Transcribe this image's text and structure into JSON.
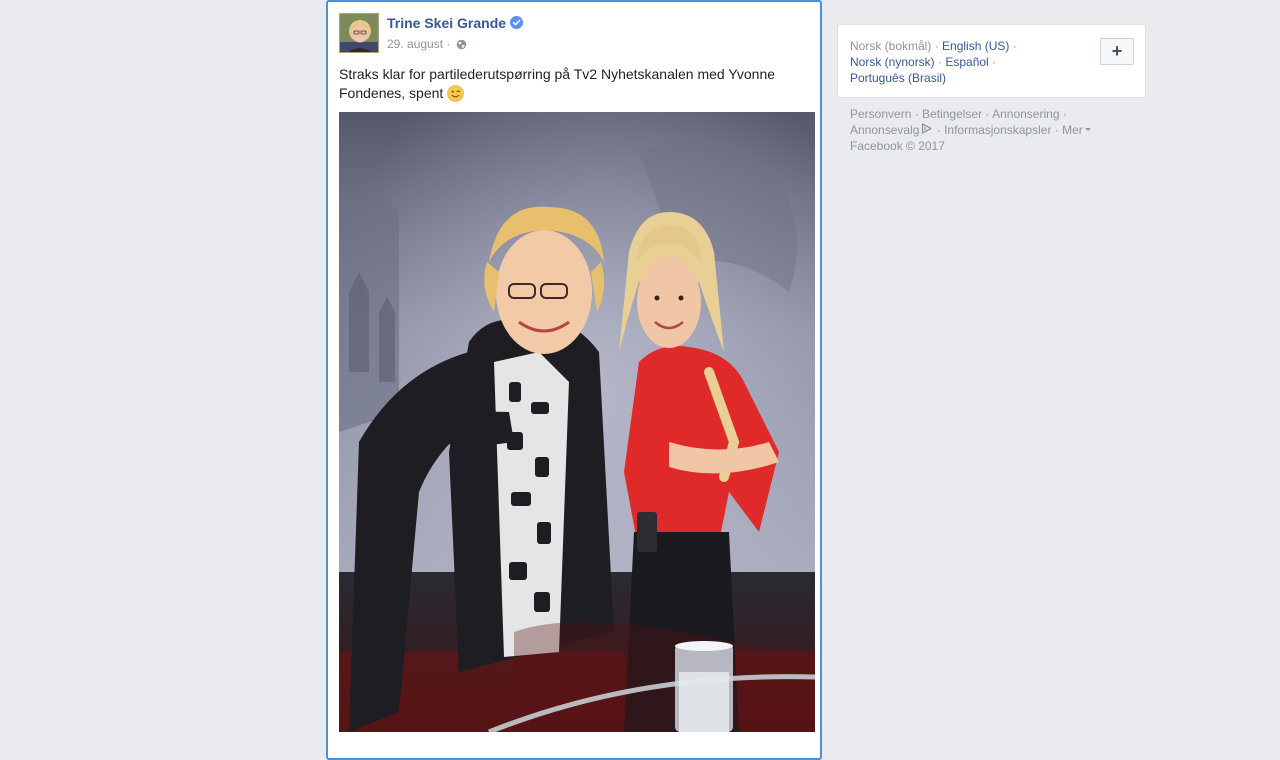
{
  "post": {
    "author": "Trine Skei Grande",
    "date": "29. august",
    "separator": "·",
    "text": "Straks klar for partilederutspørring på Tv2 Nyhetskanalen med Yvonne Fondenes, spent",
    "verified_icon": "verified-badge-icon",
    "privacy_icon": "globe-icon",
    "emoji_icon": "wink-emoji-icon"
  },
  "languages": {
    "current": "Norsk (bokmål)",
    "items": [
      "English (US)",
      "Norsk (nynorsk)",
      "Español",
      "Português (Brasil)"
    ],
    "add_label": "+"
  },
  "footer": {
    "links": [
      "Personvern",
      "Betingelser",
      "Annonsering",
      "Annonsevalg",
      "Informasjonskapsler",
      "Mer"
    ],
    "copyright": "Facebook © 2017"
  },
  "colors": {
    "link": "#365899",
    "background": "#e9ebee",
    "focus_border": "#4a90e2",
    "muted": "#90949c"
  }
}
